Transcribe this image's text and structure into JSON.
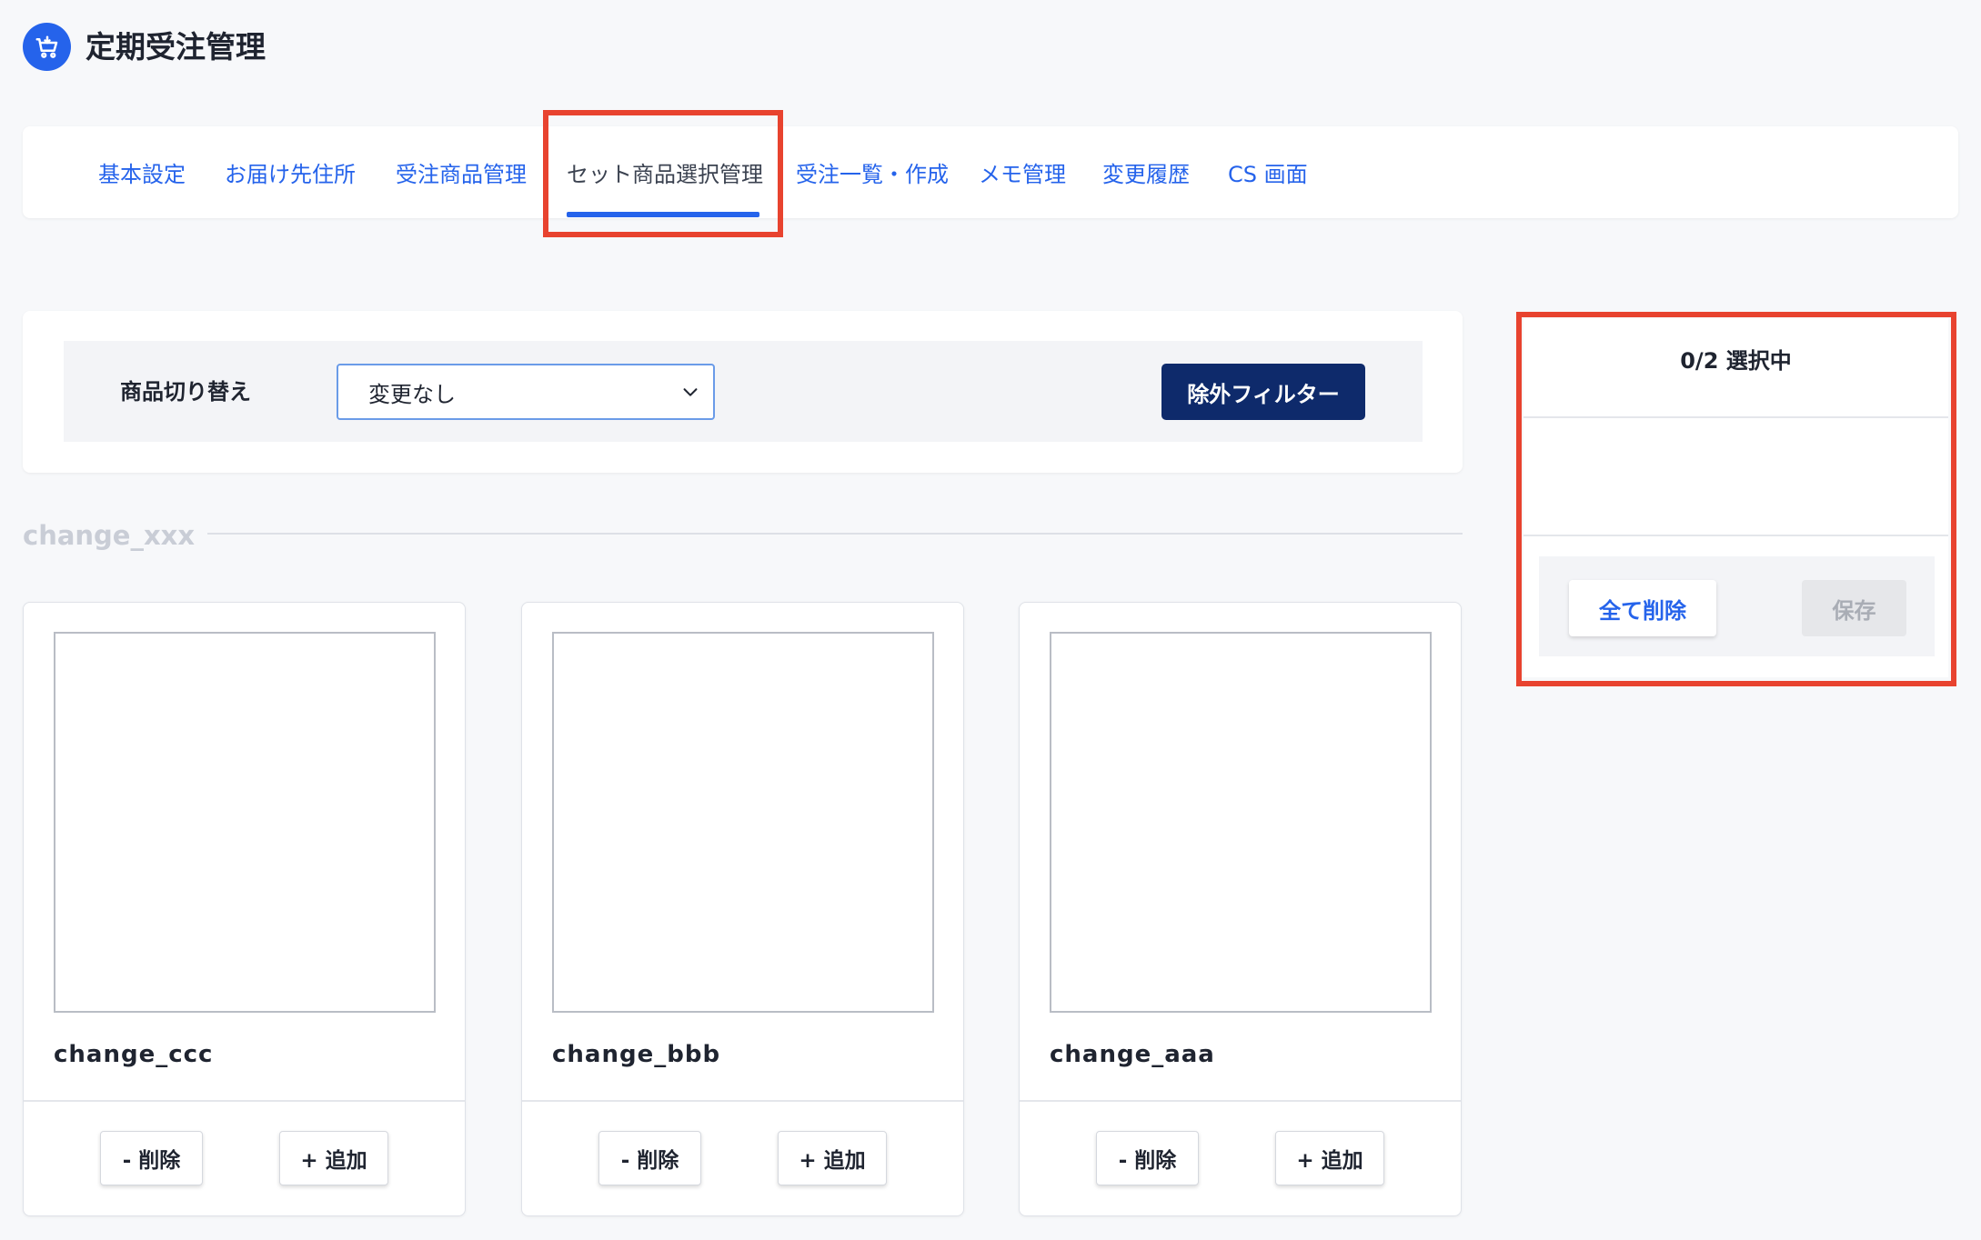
{
  "header": {
    "logo_icon": "cart-icon",
    "title": "定期受注管理"
  },
  "tabs": [
    {
      "label": "基本設定",
      "active": false
    },
    {
      "label": "お届け先住所",
      "active": false
    },
    {
      "label": "受注商品管理",
      "active": false
    },
    {
      "label": "セット商品選択管理",
      "active": true
    },
    {
      "label": "受注一覧・作成",
      "active": false
    },
    {
      "label": "メモ管理",
      "active": false
    },
    {
      "label": "変更履歴",
      "active": false
    },
    {
      "label": "CS 画面",
      "active": false
    }
  ],
  "filter": {
    "label": "商品切り替え",
    "select_value": "変更なし",
    "exclude_button": "除外フィルター"
  },
  "section": {
    "title": "change_xxx"
  },
  "products": [
    {
      "name": "change_ccc",
      "remove_label": "- 削除",
      "add_label": "+ 追加"
    },
    {
      "name": "change_bbb",
      "remove_label": "- 削除",
      "add_label": "+ 追加"
    },
    {
      "name": "change_aaa",
      "remove_label": "- 削除",
      "add_label": "+ 追加"
    }
  ],
  "selection": {
    "count_text": "0/2 選択中",
    "clear_all": "全て削除",
    "save": "保存"
  },
  "colors": {
    "accent": "#2563eb",
    "primary_dark": "#0e2a6b",
    "highlight": "#e8432f"
  }
}
